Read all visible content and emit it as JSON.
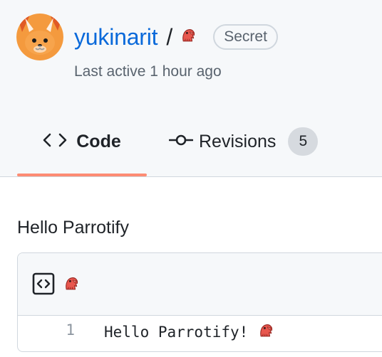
{
  "gist": {
    "owner": "yukinarit",
    "separator": "/",
    "visibility_badge": "Secret",
    "last_active": "Last active 1 hour ago",
    "description": "Hello Parrotify"
  },
  "tabs": [
    {
      "label": "Code",
      "icon": "code-icon",
      "selected": true
    },
    {
      "label": "Revisions",
      "icon": "git-commit-icon",
      "count": "5",
      "selected": false
    }
  ],
  "file": {
    "icon": "file-code-icon",
    "name_icon": "parrot-emoji",
    "lines": [
      {
        "number": "1",
        "text": "Hello Parrotify!",
        "emoji": "parrot-emoji"
      }
    ]
  },
  "colors": {
    "link": "#0969da",
    "muted_text": "#59636e",
    "header_bg": "#f6f8fa",
    "border": "#d0d7de",
    "tab_underline": "#fd8c73",
    "avatar_orange": "#f6a04a",
    "parrot_red": "#e8574e"
  }
}
